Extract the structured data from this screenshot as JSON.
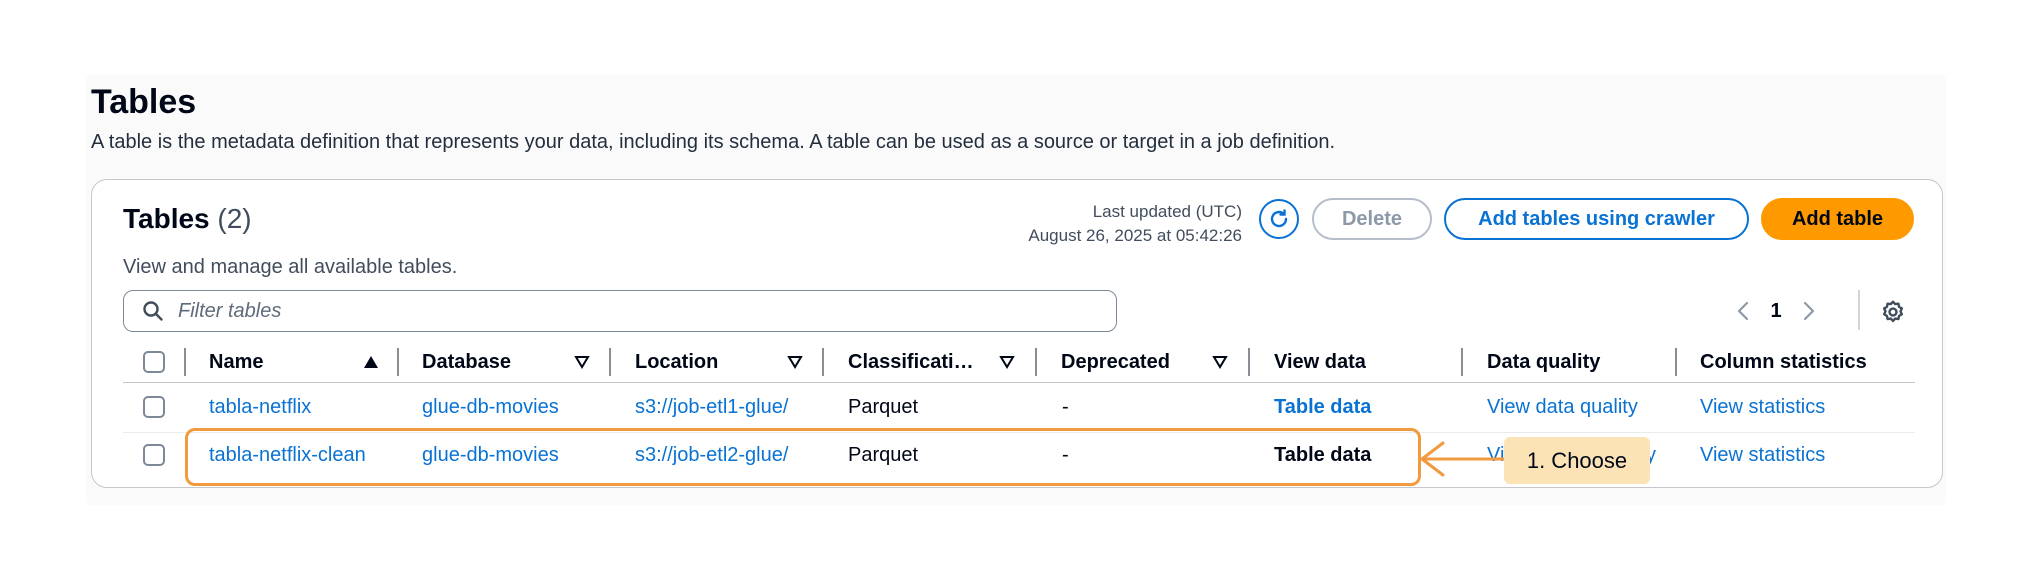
{
  "page": {
    "title": "Tables",
    "description": "A table is the metadata definition that represents your data, including its schema. A table can be used as a source or target in a job definition."
  },
  "card": {
    "title": "Tables",
    "count": "(2)",
    "description": "View and manage all available tables.",
    "last_updated_label": "Last updated (UTC)",
    "last_updated_value": "August 26, 2025 at 05:42:26",
    "buttons": {
      "delete": "Delete",
      "add_crawler": "Add tables using crawler",
      "add_table": "Add table"
    },
    "filter_placeholder": "Filter tables",
    "pagination": {
      "current_page": "1"
    }
  },
  "table": {
    "columns": [
      "Name",
      "Database",
      "Location",
      "Classificati…",
      "Deprecated",
      "View data",
      "Data quality",
      "Column statistics"
    ],
    "rows": [
      {
        "name": "tabla-netflix",
        "database": "glue-db-movies",
        "location": "s3://job-etl1-glue/",
        "classification": "Parquet",
        "deprecated": "-",
        "view_data": "Table data",
        "data_quality": "View data quality",
        "column_statistics": "View statistics"
      },
      {
        "name": "tabla-netflix-clean",
        "database": "glue-db-movies",
        "location": "s3://job-etl2-glue/",
        "classification": "Parquet",
        "deprecated": "-",
        "view_data": "Table data",
        "data_quality": "Vi",
        "data_quality_tail": "y",
        "column_statistics": "View statistics"
      }
    ]
  },
  "annotation": {
    "callout_text": "1. Choose"
  },
  "colors": {
    "link": "#0972d3",
    "primary_button": "#ff9900",
    "highlight_border": "#f19a3e",
    "callout_background": "#fbe3b6"
  },
  "icons": [
    "search-icon",
    "refresh-icon",
    "sort-ascending-icon",
    "sort-descending-icon",
    "chevron-left-icon",
    "chevron-right-icon",
    "settings-icon",
    "arrow-left-icon"
  ]
}
